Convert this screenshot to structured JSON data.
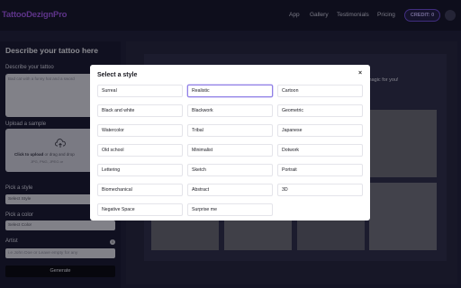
{
  "header": {
    "logo": "TattooDezignPro",
    "nav": [
      "App",
      "Gallery",
      "Testimonials",
      "Pricing"
    ],
    "credit": "CREDIT: 0"
  },
  "left_panel": {
    "title": "Describe your tattoo here",
    "describe_label": "Describe your tattoo",
    "describe_placeholder": "Bad cat with a funny hat and a sword",
    "upload_label": "Upload a sample",
    "upload_click": "Click to upload",
    "upload_rest": " or drag and drop",
    "upload_formats": "JPG, PNG, JPEG or",
    "style_label": "Pick a style",
    "style_value": "Select Style",
    "color_label": "Pick a color",
    "color_value": "Select Color",
    "artist_label": "Artist",
    "artist_placeholder": "i.e John Doe or Leave empty for any",
    "generate_label": "Generate"
  },
  "right_panel": {
    "hint": "magic for you!"
  },
  "modal": {
    "title": "Select a style",
    "close": "×",
    "selected": "Realistic",
    "options": [
      "Surreal",
      "Realistic",
      "Cartoon",
      "Black and white",
      "Blackwork",
      "Geometric",
      "Watercolor",
      "Tribal",
      "Japanese",
      "Old school",
      "Minimalist",
      "Dotwork",
      "Lettering",
      "Sketch",
      "Portrait",
      "Biomechanical",
      "Abstract",
      "3D",
      "Negative Space",
      "Surprise me"
    ]
  },
  "colors": {
    "accent": "#8f7fe6",
    "logo": "#a055e8",
    "background": "#1c1c33"
  },
  "icons": {
    "upload": "upload-cloud-icon",
    "info": "info-icon",
    "close": "close-icon"
  }
}
